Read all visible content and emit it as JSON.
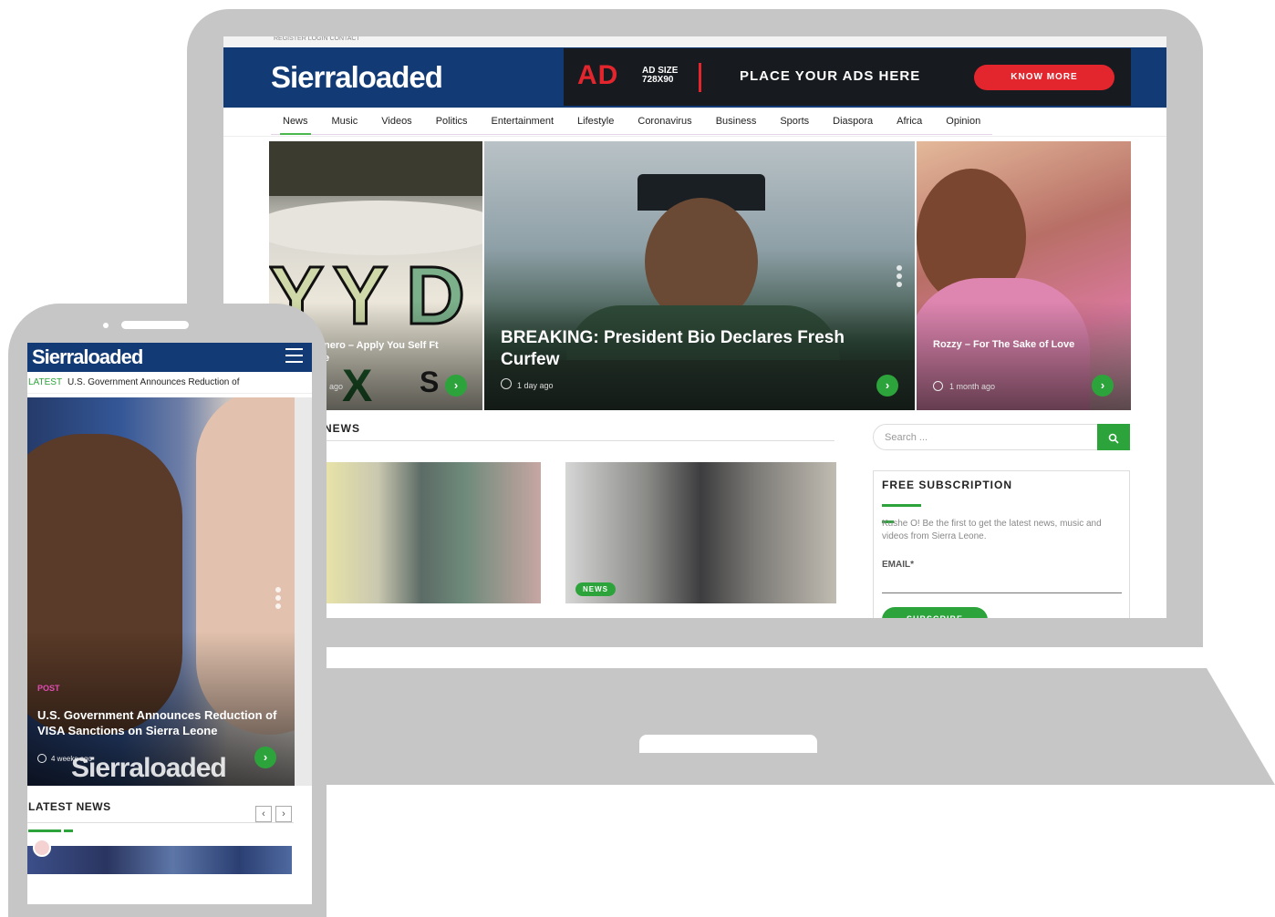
{
  "desktop": {
    "topbar": "REGISTER   LOGIN   CONTACT",
    "logo": "Sierraloaded",
    "ad": {
      "word": "AD",
      "size": "AD SIZE 728X90",
      "place": "PLACE YOUR ADS HERE",
      "cta": "KNOW MORE",
      "colors": {
        "bg": "#171b20",
        "accent": "#e3262d"
      }
    },
    "nav": [
      "News",
      "Music",
      "Videos",
      "Politics",
      "Entertainment",
      "Lifestyle",
      "Coronavirus",
      "Business",
      "Sports",
      "Diaspora",
      "Africa",
      "Opinion"
    ],
    "slides": [
      {
        "title": "nero – Apply You Self Ft",
        "title2": "e",
        "time": "ago"
      },
      {
        "title": "BREAKING: President Bio Declares Fresh Curfew",
        "time": "1 day ago"
      },
      {
        "title": "Rozzy – For The Sake of Love",
        "time": "1 month ago"
      }
    ],
    "section_title": "NEWS",
    "badge": "NEWS",
    "search_placeholder": "Search ...",
    "subscription": {
      "title": "FREE SUBSCRIPTION",
      "description": "Kushe O! Be the first to get the latest news, music and videos from Sierra Leone.",
      "email_label": "EMAIL*",
      "button": "SUBSCRIBE"
    },
    "colors": {
      "brand": "#123a74",
      "green": "#2ca43b"
    }
  },
  "mobile": {
    "logo": "Sierraloaded",
    "ticker_label": "LATEST",
    "ticker_text": "U.S. Government Announces Reduction of",
    "hero": {
      "tag": "POST",
      "title": "U.S. Government Announces Reduction of VISA Sanctions on Sierra Leone",
      "time": "4 weeks ago",
      "watermark": "Sierraloaded"
    },
    "latest_title": "LATEST NEWS",
    "prev": "‹",
    "next": "›"
  }
}
